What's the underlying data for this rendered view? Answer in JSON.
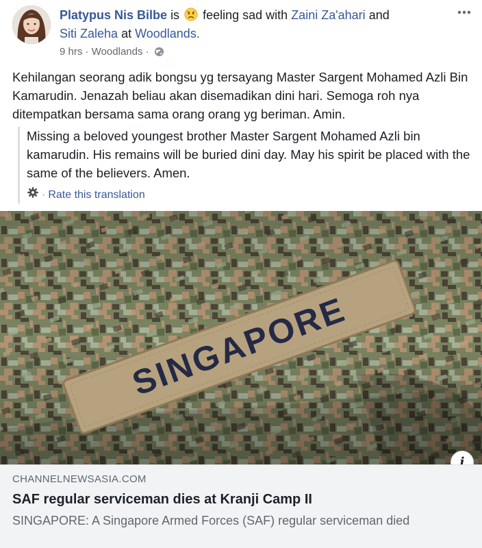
{
  "post": {
    "author": "Platypus Nis Bilbe",
    "is_word": "is",
    "feeling_text": "feeling sad with",
    "tagged_1": "Zaini Za'ahari",
    "and_word": "and",
    "tagged_2": "Siti Zaleha",
    "at_word": "at",
    "location": "Woodlands.",
    "time": "9 hrs",
    "sep": "·",
    "place": "Woodlands",
    "body": "Kehilangan seorang adik bongsu yg tersayang Master Sargent Mohamed Azli Bin Kamarudin. Jenazah beliau akan disemadikan dini hari. Semoga roh nya ditempatkan bersama sama orang orang yg beriman. Amin.",
    "translation": "Missing a beloved youngest brother Master Sargent Mohamed Azli bin kamarudin. His remains will be buried dini day. May his spirit be placed with the same of the believers. Amen.",
    "rate_translation": "Rate this translation"
  },
  "photo": {
    "patch_text": "SINGAPORE",
    "info_label": "i"
  },
  "link_card": {
    "domain": "CHANNELNEWSASIA.COM",
    "title": "SAF regular serviceman dies at Kranji Camp II",
    "description": "SINGAPORE: A Singapore Armed Forces (SAF) regular serviceman died"
  },
  "icons": {
    "feeling": "sad-face-emoji",
    "privacy": "globe-icon",
    "menu": "more-options-icon",
    "settings": "gear-icon",
    "info": "info-icon"
  },
  "colors": {
    "link": "#385898",
    "muted": "#616770",
    "card_bg": "#f2f3f5"
  }
}
